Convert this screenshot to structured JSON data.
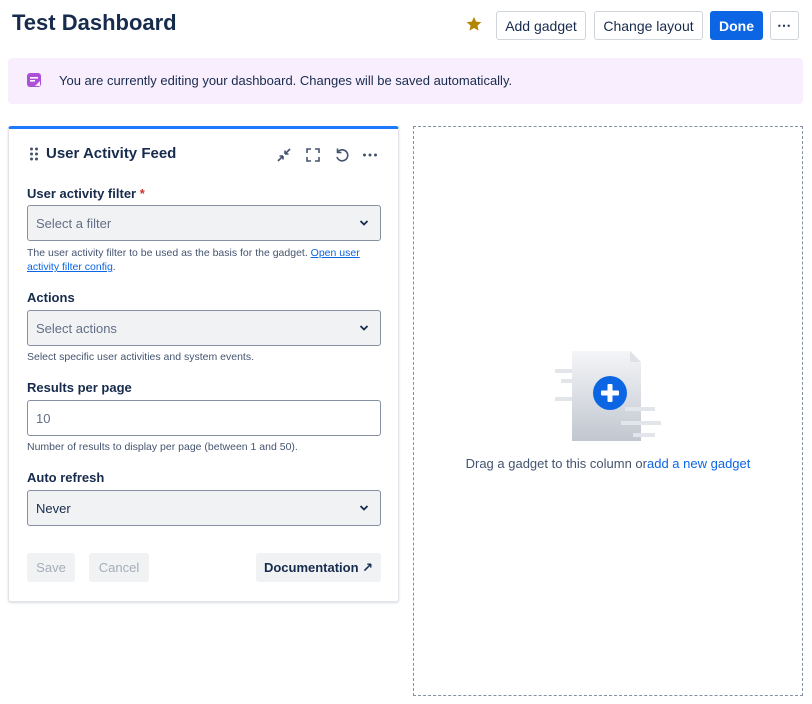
{
  "header": {
    "title": "Test Dashboard",
    "add_gadget": "Add gadget",
    "change_layout": "Change layout",
    "done": "Done",
    "more": "⋯"
  },
  "banner": {
    "text": "You are currently editing your dashboard. Changes will be saved automatically."
  },
  "gadget": {
    "title": "User Activity Feed",
    "fields": {
      "filter_label": "User activity filter",
      "filter_required": "*",
      "filter_placeholder": "Select a filter",
      "filter_help": "The user activity filter to be used as the basis for the gadget.",
      "filter_help_link": "Open user activity filter config",
      "filter_help_end": ".",
      "actions_label": "Actions",
      "actions_placeholder": "Select actions",
      "actions_help": "Select specific user activities and system events.",
      "results_label": "Results per page",
      "results_value": "10",
      "results_help": "Number of results to display per page (between 1 and 50).",
      "refresh_label": "Auto refresh",
      "refresh_value": "Never"
    },
    "footer": {
      "save": "Save",
      "cancel": "Cancel",
      "documentation": "Documentation ↗"
    }
  },
  "dropzone": {
    "text": "Drag a gadget to this column or",
    "link": "add a new gadget"
  },
  "colors": {
    "primary": "#0c66e4",
    "banner_bg": "#f8eefe",
    "banner_icon": "#ae4fd8",
    "star": "#b38600",
    "required": "#c9372c"
  }
}
